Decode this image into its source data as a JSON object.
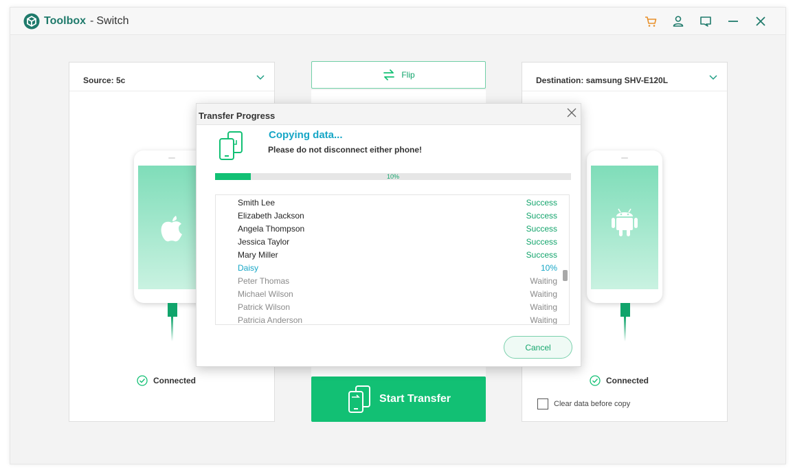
{
  "app": {
    "brand": "Toolbox",
    "separator": "-",
    "title": "Switch",
    "colors": {
      "brand": "#1f7a6b",
      "accent": "#12c074",
      "cart": "#e8902a",
      "link": "#16a6c6"
    }
  },
  "titlebar": {
    "icons": [
      "cart-icon",
      "user-icon",
      "feedback-icon",
      "minimize-icon",
      "close-icon"
    ]
  },
  "source": {
    "label": "Source:  5c",
    "status": "Connected",
    "platform_icon": "apple-icon"
  },
  "destination": {
    "label": "Destination: samsung SHV-E120L",
    "status": "Connected",
    "platform_icon": "android-icon",
    "clear_data_label": "Clear data before copy",
    "clear_data_checked": false
  },
  "center": {
    "flip_label": "Flip",
    "start_label": "Start Transfer"
  },
  "dialog": {
    "title": "Transfer Progress",
    "heading": "Copying data...",
    "warning": "Please do not disconnect either phone!",
    "progress_fraction": 0.1,
    "progress_text": "10%",
    "cancel_label": "Cancel",
    "items": [
      {
        "name": "Smith Lee",
        "status": "Success",
        "state": "done"
      },
      {
        "name": "Elizabeth Jackson",
        "status": "Success",
        "state": "done"
      },
      {
        "name": "Angela Thompson",
        "status": "Success",
        "state": "done"
      },
      {
        "name": "Jessica Taylor",
        "status": "Success",
        "state": "done"
      },
      {
        "name": "Mary Miller",
        "status": "Success",
        "state": "done"
      },
      {
        "name": "Daisy",
        "status": "10%",
        "state": "active"
      },
      {
        "name": "Peter Thomas",
        "status": "Waiting",
        "state": "waiting"
      },
      {
        "name": "Michael Wilson",
        "status": "Waiting",
        "state": "waiting"
      },
      {
        "name": "Patrick Wilson",
        "status": "Waiting",
        "state": "waiting"
      },
      {
        "name": "Patricia Anderson",
        "status": "Waiting",
        "state": "waiting"
      }
    ]
  }
}
